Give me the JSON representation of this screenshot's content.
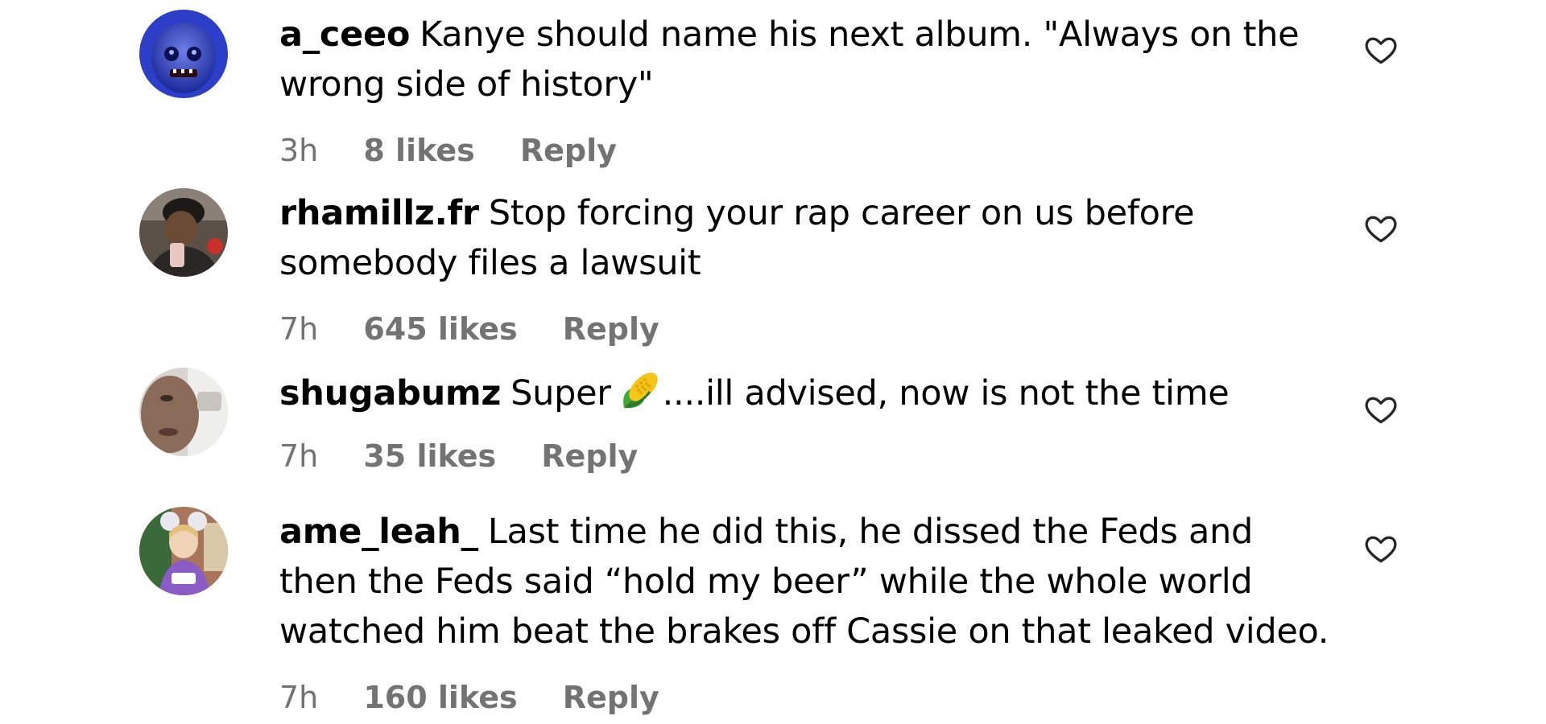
{
  "comments": [
    {
      "username": "a_ceeo",
      "text": "Kanye should name his next album. \"Always on the wrong side of history\"",
      "time": "3h",
      "likes": "8 likes",
      "reply": "Reply",
      "avatar_icon": "blue-monster-avatar",
      "like_icon": "heart-outline-icon"
    },
    {
      "username": "rhamillz.fr",
      "text": "Stop forcing your rap career on us before somebody files a lawsuit",
      "time": "7h",
      "likes": "645 likes",
      "reply": "Reply",
      "avatar_icon": "person-selfie-avatar",
      "like_icon": "heart-outline-icon"
    },
    {
      "username": "shugabumz",
      "text_before": "Super",
      "emoji": "corn-emoji",
      "text_after": "....ill advised, now is not the time",
      "time": "7h",
      "likes": "35 likes",
      "reply": "Reply",
      "avatar_icon": "person-closeup-avatar",
      "like_icon": "heart-outline-icon"
    },
    {
      "username": "ame_leah_",
      "text": "Last time he did this, he dissed the Feds and then the Feds said “hold my beer” while the whole world watched him beat the brakes off Cassie on that leaked video.",
      "time": "7h",
      "likes": "160 likes",
      "reply": "Reply",
      "avatar_icon": "child-with-ears-avatar",
      "like_icon": "heart-outline-icon"
    }
  ],
  "colors": {
    "text": "#000000",
    "meta": "#737373",
    "background": "#ffffff"
  }
}
